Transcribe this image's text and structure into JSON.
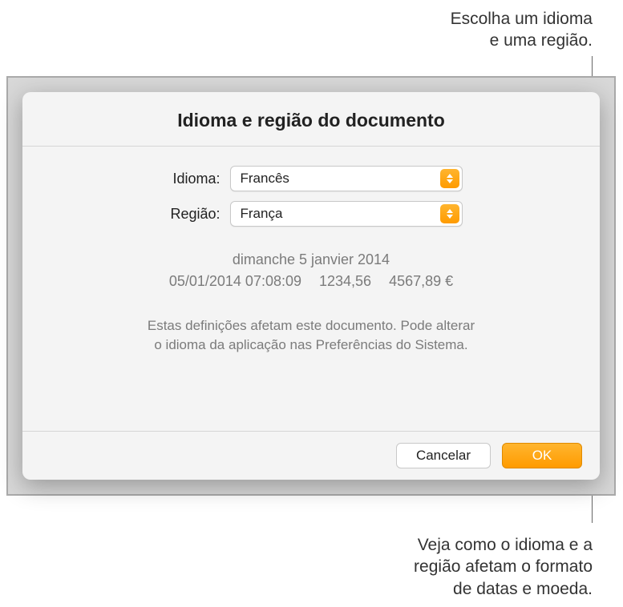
{
  "callouts": {
    "top": "Escolha um idioma\ne uma região.",
    "bottom": "Veja como o idioma e a\nregião afetam o formato\nde datas e moeda."
  },
  "dialog": {
    "title": "Idioma e região do documento",
    "form": {
      "language_label": "Idioma:",
      "language_value": "Francês",
      "region_label": "Região:",
      "region_value": "França"
    },
    "preview": {
      "long_date": "dimanche 5 janvier 2014",
      "datetime": "05/01/2014 07:08:09",
      "number": "1234,56",
      "currency": "4567,89 €"
    },
    "help": "Estas definições afetam este documento. Pode alterar\no idioma da aplicação nas Preferências do Sistema.",
    "buttons": {
      "cancel": "Cancelar",
      "ok": "OK"
    }
  }
}
